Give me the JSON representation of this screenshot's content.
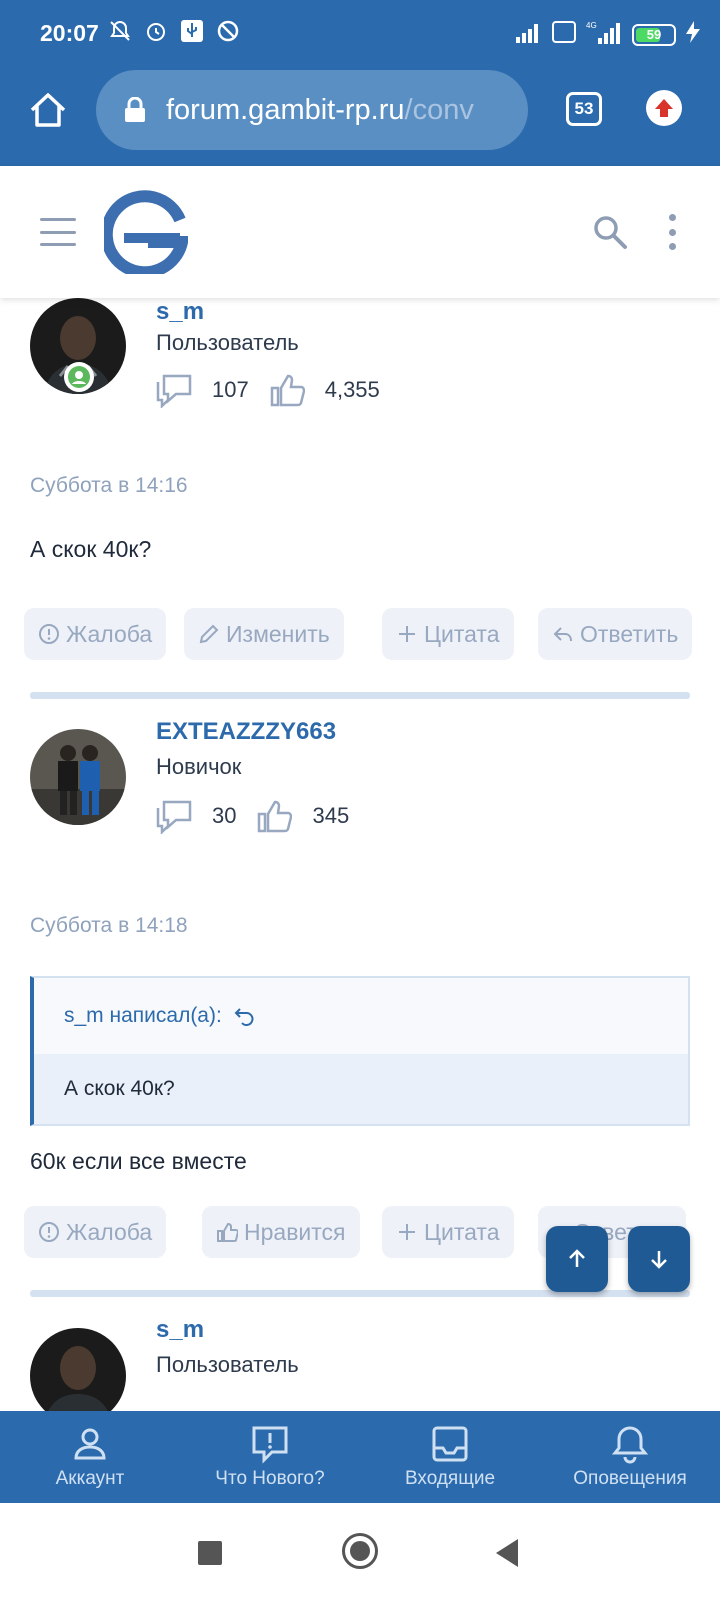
{
  "status_bar": {
    "time": "20:07",
    "battery_percent": "59",
    "network": "4G"
  },
  "browser": {
    "url_host": "forum.gambit-rp.ru",
    "url_path": "/conv",
    "tab_count": "53"
  },
  "posts": [
    {
      "username": "s_m",
      "user_title": "Пользователь",
      "messages_count": "107",
      "likes_count": "4,355",
      "date": "Суббота в 14:16",
      "text": "А скок 40к?",
      "actions": [
        "Жалоба",
        "Изменить",
        "Цитата",
        "Ответить"
      ]
    },
    {
      "username": "EXTEAZZZY663",
      "user_title": "Новичок",
      "messages_count": "30",
      "likes_count": "345",
      "date": "Суббота в 14:18",
      "quote": {
        "author_line": "s_m написал(а):",
        "text": "А скок 40к?"
      },
      "text": "60к если все вместе",
      "actions": [
        "Жалоба",
        "Нравится",
        "Цитата",
        "Ответить"
      ]
    },
    {
      "username": "s_m",
      "user_title": "Пользователь"
    }
  ],
  "bottom_nav": [
    {
      "label": "Аккаунт",
      "icon": "user-icon"
    },
    {
      "label": "Что Нового?",
      "icon": "whats-new-icon"
    },
    {
      "label": "Входящие",
      "icon": "inbox-icon"
    },
    {
      "label": "Оповещения",
      "icon": "bell-icon"
    }
  ],
  "colors": {
    "brand": "#2b6aad",
    "link": "#2c6aab",
    "muted": "#98a8c0"
  }
}
